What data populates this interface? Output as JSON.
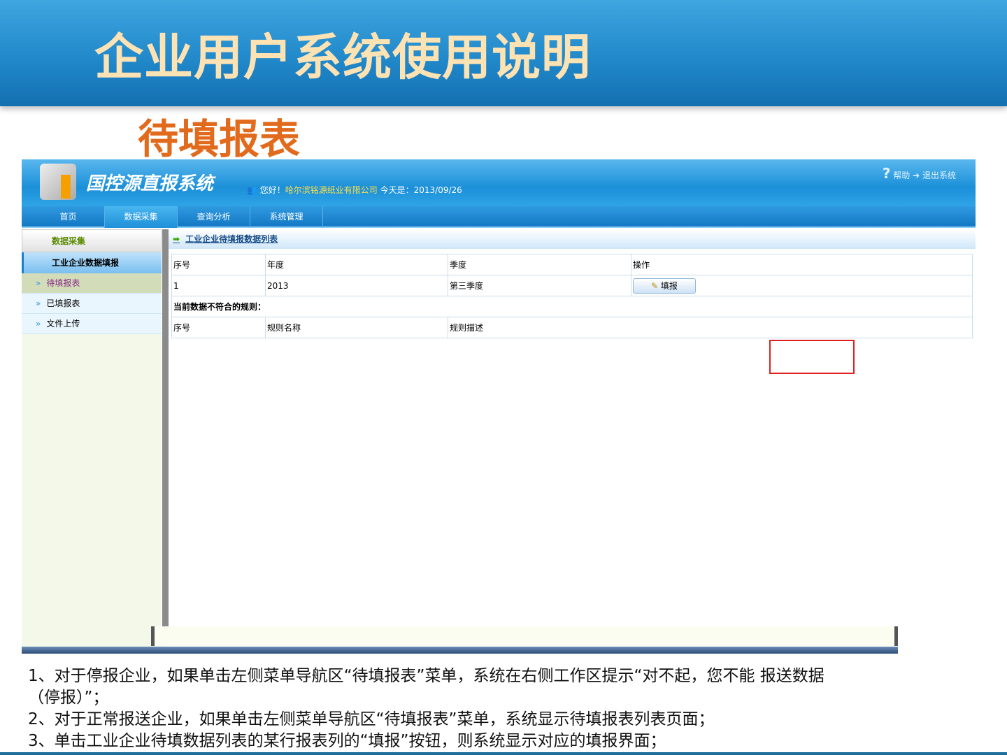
{
  "slide": {
    "title": "企业用户系统使用说明",
    "subtitle": "待填报表"
  },
  "app": {
    "name": "国控源直报系统",
    "greeting": "您好！",
    "company": "哈尔滨铭源纸业有限公司",
    "date_label": "今天是：2013/09/26",
    "help": "帮助",
    "logout": "退出系统"
  },
  "nav": [
    "首页",
    "数据采集",
    "查询分析",
    "系统管理"
  ],
  "sidebar": {
    "header": "数据采集",
    "group": "工业企业数据填报",
    "items": [
      "待填报表",
      "已填报表",
      "文件上传"
    ]
  },
  "main": {
    "caption": "工业企业待填报数据列表",
    "columns": [
      "序号",
      "年度",
      "季度",
      "操作"
    ],
    "rows": [
      {
        "no": "1",
        "year": "2013",
        "quarter": "第三季度",
        "action": "填报"
      }
    ],
    "rules_title": "当前数据不符合的规则：",
    "rule_columns": [
      "序号",
      "规则名称",
      "规则描述"
    ]
  },
  "notes": [
    "1、对于停报企业，如果单击左侧菜单导航区“待填报表”菜单，系统在右侧工作区提示“对不起，您不能 报送数据",
    "（停报）”；",
    "2、对于正常报送企业，如果单击左侧菜单导航区“待填报表”菜单，系统显示待填报表列表页面；",
    "3、单击工业企业待填数据列表的某行报表列的“填报”按钮，则系统显示对应的填报界面；"
  ]
}
